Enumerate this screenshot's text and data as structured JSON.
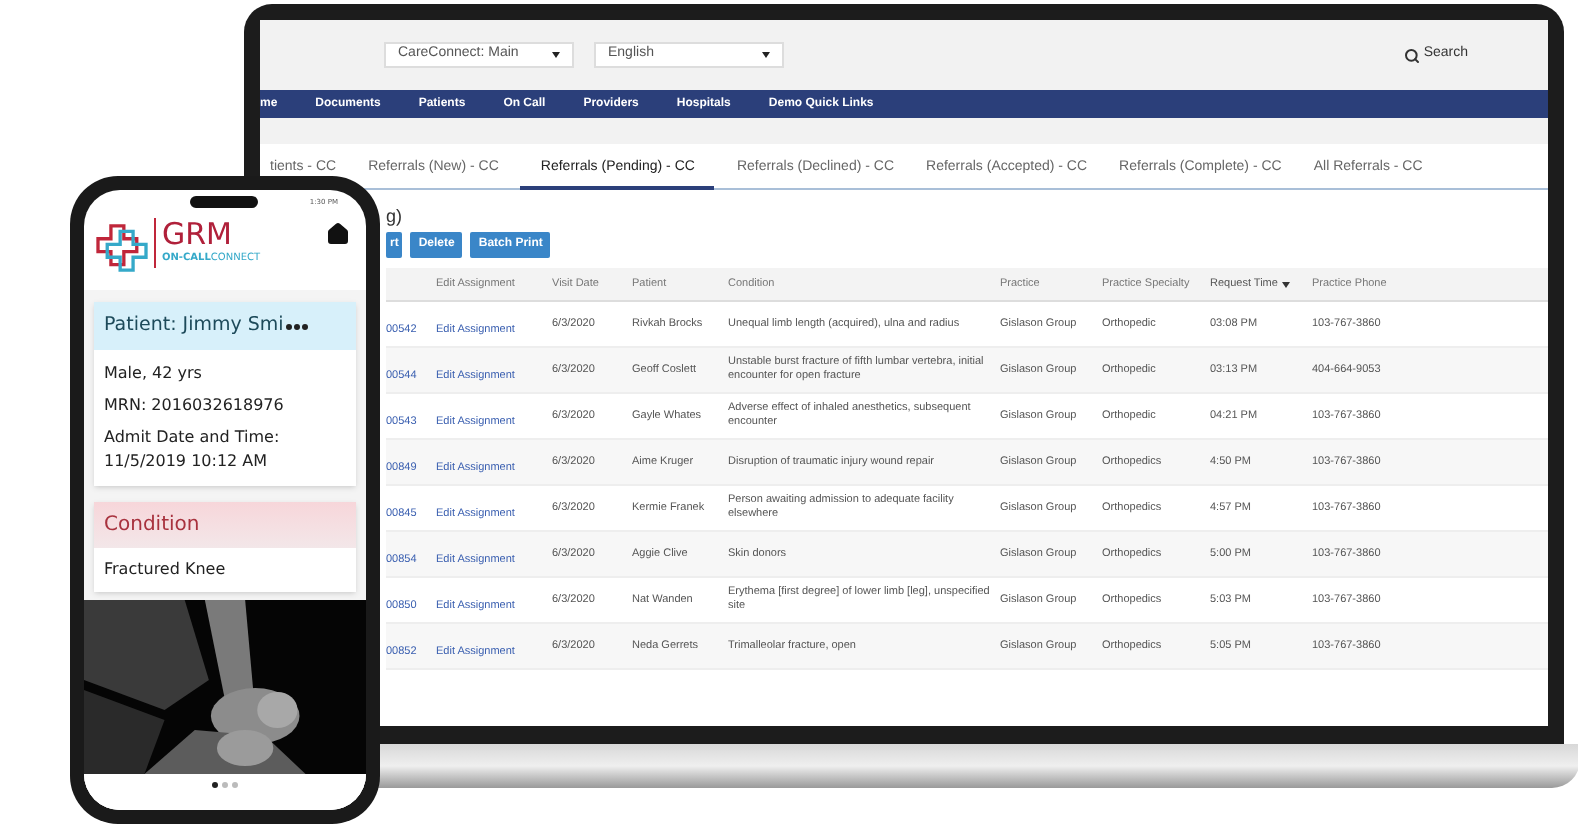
{
  "laptop": {
    "selects": [
      {
        "value": "CareConnect: Main"
      },
      {
        "value": "English"
      }
    ],
    "search": "Search",
    "nav": [
      "me",
      "Documents",
      "Patients",
      "On Call",
      "Providers",
      "Hospitals",
      "Demo Quick Links"
    ],
    "tabs": [
      {
        "label": "tients - CC",
        "selected": false
      },
      {
        "label": "Referrals (New) - CC",
        "selected": false
      },
      {
        "label": "Referrals (Pending) - CC",
        "selected": true
      },
      {
        "label": "Referrals (Declined) - CC",
        "selected": false
      },
      {
        "label": "Referrals (Accepted) - CC",
        "selected": false
      },
      {
        "label": "Referrals (Complete) - CC",
        "selected": false
      },
      {
        "label": "All Referrals - CC",
        "selected": false
      }
    ],
    "page_title": "g)",
    "buttons": [
      "rt",
      "Delete",
      "Batch Print"
    ],
    "table": {
      "columns": [
        {
          "label": "Edit Assignment",
          "sorted": false
        },
        {
          "label": "Visit Date",
          "sorted": false
        },
        {
          "label": "Patient",
          "sorted": false
        },
        {
          "label": "Condition",
          "sorted": false
        },
        {
          "label": "Practice",
          "sorted": false
        },
        {
          "label": "Practice Specialty",
          "sorted": false
        },
        {
          "label": "Request Time",
          "sorted": true
        },
        {
          "label": "Practice Phone",
          "sorted": false
        }
      ],
      "rows": [
        {
          "id": "00542",
          "edit": "Edit Assignment",
          "visit_date": "6/3/2020",
          "patient": "Rivkah Brocks",
          "condition": "Unequal limb length (acquired), ulna and radius",
          "practice": "Gislason Group",
          "specialty": "Orthopedic",
          "request_time": "03:08 PM",
          "phone": "103-767-3860"
        },
        {
          "id": "00544",
          "edit": "Edit Assignment",
          "visit_date": "6/3/2020",
          "patient": "Geoff Coslett",
          "condition": "Unstable burst fracture of fifth lumbar vertebra, initial encounter for open fracture",
          "practice": "Gislason Group",
          "specialty": "Orthopedic",
          "request_time": "03:13 PM",
          "phone": "404-664-9053"
        },
        {
          "id": "00543",
          "edit": "Edit Assignment",
          "visit_date": "6/3/2020",
          "patient": "Gayle Whates",
          "condition": "Adverse effect of inhaled anesthetics, subsequent encounter",
          "practice": "Gislason Group",
          "specialty": "Orthopedic",
          "request_time": "04:21 PM",
          "phone": "103-767-3860"
        },
        {
          "id": "00849",
          "edit": "Edit Assignment",
          "visit_date": "6/3/2020",
          "patient": "Aime Kruger",
          "condition": "Disruption of traumatic injury wound repair",
          "practice": "Gislason Group",
          "specialty": "Orthopedics",
          "request_time": "4:50 PM",
          "phone": "103-767-3860"
        },
        {
          "id": "00845",
          "edit": "Edit Assignment",
          "visit_date": "6/3/2020",
          "patient": "Kermie Franek",
          "condition": "Person awaiting admission to adequate facility elsewhere",
          "practice": "Gislason Group",
          "specialty": "Orthopedics",
          "request_time": "4:57 PM",
          "phone": "103-767-3860"
        },
        {
          "id": "00854",
          "edit": "Edit Assignment",
          "visit_date": "6/3/2020",
          "patient": "Aggie Clive",
          "condition": "Skin donors",
          "practice": "Gislason Group",
          "specialty": "Orthopedics",
          "request_time": "5:00 PM",
          "phone": "103-767-3860"
        },
        {
          "id": "00850",
          "edit": "Edit Assignment",
          "visit_date": "6/3/2020",
          "patient": "Nat Wanden",
          "condition": "Erythema [first degree] of lower limb [leg], unspecified site",
          "practice": "Gislason Group",
          "specialty": "Orthopedics",
          "request_time": "5:03 PM",
          "phone": "103-767-3860"
        },
        {
          "id": "00852",
          "edit": "Edit Assignment",
          "visit_date": "6/3/2020",
          "patient": "Neda Gerrets",
          "condition": "Trimalleolar fracture, open",
          "practice": "Gislason Group",
          "specialty": "Orthopedics",
          "request_time": "5:05 PM",
          "phone": "103-767-3860"
        }
      ]
    }
  },
  "phone": {
    "status_time": "1:30 PM",
    "logo": {
      "name": "GRM",
      "line1": "ON-CALL",
      "line2": "CONNECT"
    },
    "patient_title": "Patient: Jimmy Smi",
    "details": [
      "Male, 42 yrs",
      "MRN: 2016032618976",
      "Admit Date and Time: 11/5/2019 10:12 AM"
    ],
    "condition_title": "Condition",
    "condition_value": "Fractured Knee",
    "pager": [
      {
        "selected": true
      },
      {
        "selected": false
      },
      {
        "selected": false
      }
    ]
  }
}
